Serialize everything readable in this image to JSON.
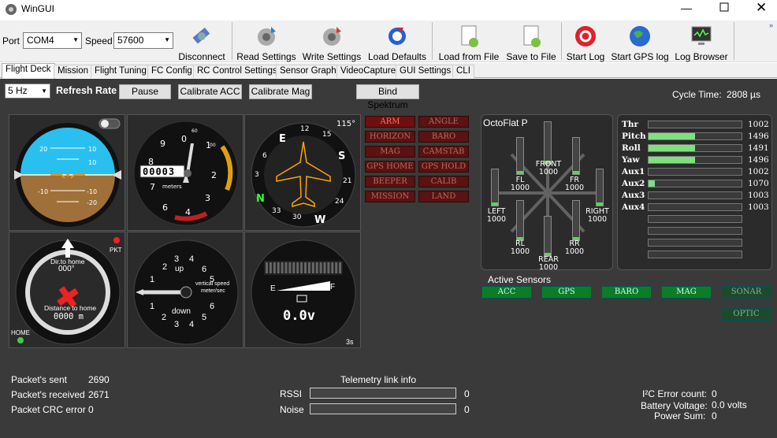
{
  "window": {
    "title": "WinGUI"
  },
  "toolbar": {
    "port_label": "Port",
    "port_value": "COM4",
    "speed_label": "Speed",
    "speed_value": "57600",
    "disconnect": "Disconnect",
    "read_settings": "Read Settings",
    "write_settings": "Write Settings",
    "load_defaults": "Load Defaults",
    "load_from_file": "Load from File",
    "save_to_file": "Save to File",
    "start_log": "Start Log",
    "start_gps_log": "Start GPS log",
    "log_browser": "Log Browser"
  },
  "tabs": [
    "Flight Deck",
    "Mission",
    "Flight Tuning",
    "FC Config",
    "RC Control Settings",
    "Sensor Graph",
    "VideoCapture",
    "GUI Settings",
    "CLI"
  ],
  "controls": {
    "refresh_value": "5 Hz",
    "refresh_label": "Refresh Rate",
    "pause": "Pause",
    "calibrate_acc": "Calibrate ACC",
    "calibrate_mag": "Calibrate Mag",
    "bind_spektrum": "Bind Spektrum",
    "cycle_label": "Cycle Time:",
    "cycle_value": "2808 µs"
  },
  "gauges": {
    "attitude_ticks": [
      "20",
      "10",
      "10",
      "-10",
      "-20",
      "-10"
    ],
    "altimeter_counter": "00003",
    "altimeter_unit": "meters",
    "altimeter_nums": [
      "9",
      "0",
      "1",
      "8",
      "2",
      "7",
      "3",
      "6",
      "5",
      "4"
    ],
    "altimeter_small": "60",
    "altimeter_hundreds": "00",
    "heading": "115°",
    "compass_letters": [
      "N",
      "E",
      "S",
      "W"
    ],
    "compass_nums": [
      "12",
      "15",
      "21",
      "24",
      "30",
      "33",
      "6",
      "3"
    ],
    "home_pkt": "PKT",
    "home_dir_label": "Dir.to home",
    "home_dir_value": "000°",
    "home_dist_label": "Distance to home",
    "home_dist_value": "0000 m",
    "home_label": "HOME",
    "vs_up": "up",
    "vs_down": "down",
    "vs_label1": "vertical speed",
    "vs_label2": "meter/sec",
    "vs_nums": [
      "4",
      "3",
      "2",
      "1",
      "0",
      "1",
      "2",
      "3",
      "4",
      "5",
      "6",
      "5",
      "6"
    ],
    "battery_e": "E",
    "battery_f": "F",
    "battery_voltage": "0.0v",
    "battery_cells": "3s"
  },
  "modes": [
    {
      "label": "ARM",
      "active": true
    },
    {
      "label": "ANGLE",
      "active": false
    },
    {
      "label": "HORIZON",
      "active": false
    },
    {
      "label": "BARO",
      "active": false
    },
    {
      "label": "MAG",
      "active": false
    },
    {
      "label": "CAMSTAB",
      "active": false
    },
    {
      "label": "GPS HOME",
      "active": false
    },
    {
      "label": "GPS HOLD",
      "active": false
    },
    {
      "label": "BEEPER",
      "active": false
    },
    {
      "label": "CALIB",
      "active": false
    },
    {
      "label": "MISSION",
      "active": false
    },
    {
      "label": "LAND",
      "active": false
    }
  ],
  "motors": {
    "title": "OctoFlat P",
    "items": [
      {
        "name": "FRONT",
        "value": "1000"
      },
      {
        "name": "FL",
        "value": "1000"
      },
      {
        "name": "FR",
        "value": "1000"
      },
      {
        "name": "LEFT",
        "value": "1000"
      },
      {
        "name": "RIGHT",
        "value": "1000"
      },
      {
        "name": "RL",
        "value": "1000"
      },
      {
        "name": "RR",
        "value": "1000"
      },
      {
        "name": "REAR",
        "value": "1000"
      }
    ]
  },
  "channels": [
    {
      "name": "Thr",
      "value": "1002",
      "level": 0.0
    },
    {
      "name": "Pitch",
      "value": "1496",
      "level": 0.5
    },
    {
      "name": "Roll",
      "value": "1491",
      "level": 0.5
    },
    {
      "name": "Yaw",
      "value": "1496",
      "level": 0.5
    },
    {
      "name": "Aux1",
      "value": "1002",
      "level": 0.0
    },
    {
      "name": "Aux2",
      "value": "1070",
      "level": 0.07
    },
    {
      "name": "Aux3",
      "value": "1003",
      "level": 0.0
    },
    {
      "name": "Aux4",
      "value": "1003",
      "level": 0.0
    }
  ],
  "sensors": {
    "title": "Active Sensors",
    "items": [
      {
        "label": "ACC",
        "active": true
      },
      {
        "label": "GPS",
        "active": true
      },
      {
        "label": "BARO",
        "active": true
      },
      {
        "label": "MAG",
        "active": true
      },
      {
        "label": "SONAR",
        "active": false
      },
      {
        "label": "OPTIC",
        "active": false
      }
    ]
  },
  "stats": {
    "sent_label": "Packet's sent",
    "sent_value": "2690",
    "received_label": "Packet's received",
    "received_value": "2671",
    "crc_label": "Packet CRC error",
    "crc_value": "0"
  },
  "telemetry": {
    "title": "Telemetry link info",
    "rssi_label": "RSSI",
    "rssi_value": "0",
    "noise_label": "Noise",
    "noise_value": "0"
  },
  "status": {
    "i2c_label": "I²C Error count:",
    "i2c_value": "0",
    "battery_label": "Battery Voltage:",
    "battery_value": "0.0 volts",
    "power_label": "Power Sum:",
    "power_value": "0"
  },
  "colors": {
    "accent_green": "#7ee07e",
    "mode_red": "#5a1212",
    "sensor_green": "#0c7d26",
    "sky": "#29c0f0",
    "ground": "#a0703a"
  }
}
